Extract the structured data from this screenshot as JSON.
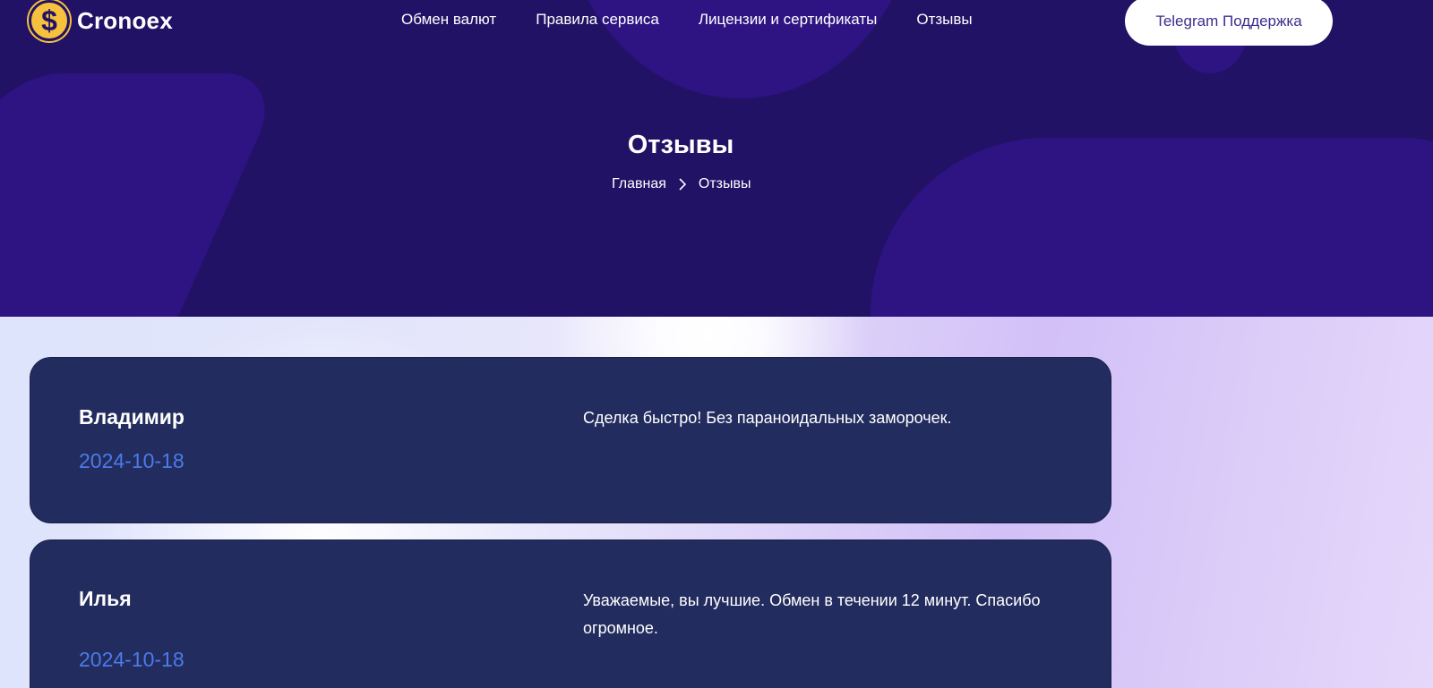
{
  "header": {
    "logo_symbol": "$",
    "logo_text": "Cronoex",
    "nav": [
      {
        "label": "Обмен валют"
      },
      {
        "label": "Правила сервиса"
      },
      {
        "label": "Лицензии и сертификаты"
      },
      {
        "label": "Отзывы"
      }
    ],
    "support_button": "Telegram Поддержка"
  },
  "hero": {
    "title": "Отзывы",
    "breadcrumb": {
      "home": "Главная",
      "current": "Отзывы"
    }
  },
  "reviews": [
    {
      "name": "Владимир",
      "date": "2024-10-18",
      "text": "Сделка быстро! Без параноидальных заморочек."
    },
    {
      "name": "Илья",
      "date": "2024-10-18",
      "text": "Уважаемые, вы лучшие. Обмен в течении 12 минут. Спасибо огромное."
    }
  ],
  "colors": {
    "hero_bg": "#221266",
    "card_bg": "#232c5e",
    "date_accent": "#4a7bea",
    "logo_gold": "#f6c23e"
  },
  "icons": {
    "logo": "dollar-coin-icon",
    "breadcrumb_separator": "chevron-right-icon"
  }
}
